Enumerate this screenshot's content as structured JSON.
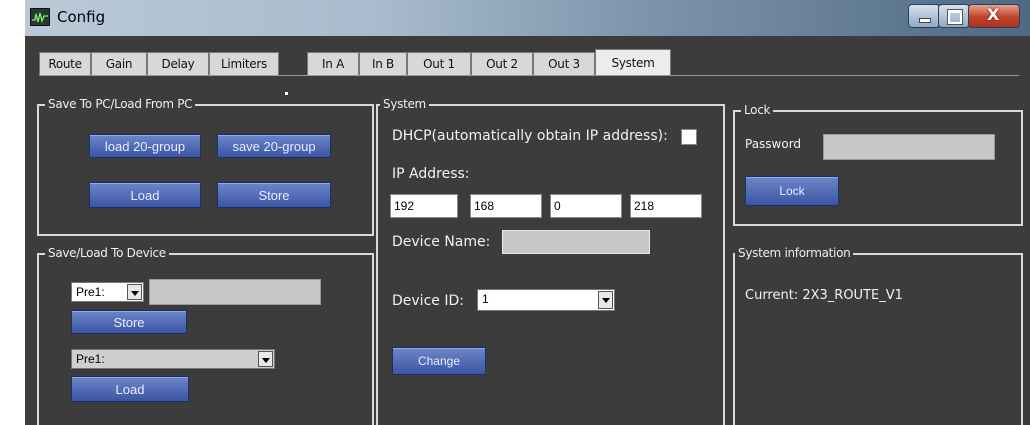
{
  "window": {
    "title": "Config",
    "icon": "waveform-icon",
    "close_glyph": "X"
  },
  "tabs": [
    {
      "label": "Route"
    },
    {
      "label": "Gain"
    },
    {
      "label": "Delay"
    },
    {
      "label": "Limiters"
    },
    {
      "label": "In A"
    },
    {
      "label": "In B"
    },
    {
      "label": "Out 1"
    },
    {
      "label": "Out 2"
    },
    {
      "label": "Out 3"
    },
    {
      "label": "System",
      "active": true
    }
  ],
  "save_pc": {
    "title": "Save To PC/Load From PC",
    "load20_label": "load 20-group",
    "save20_label": "save 20-group",
    "load_label": "Load",
    "store_label": "Store"
  },
  "save_device": {
    "title": "Save/Load To Device",
    "preset_select": "Pre1:",
    "store_label": "Store",
    "load_select": "Pre1:",
    "load_label": "Load"
  },
  "system": {
    "title": "System",
    "dhcp_label": "DHCP(automatically obtain IP address):",
    "dhcp_checked": false,
    "ip_label": "IP Address:",
    "ip": [
      "192",
      "168",
      "0",
      "218"
    ],
    "device_name_label": "Device Name:",
    "device_name_value": "",
    "device_id_label": "Device ID:",
    "device_id_value": "1",
    "change_label": "Change"
  },
  "lock": {
    "title": "Lock",
    "password_label": "Password",
    "password_value": "",
    "lock_label": "Lock"
  },
  "sysinfo": {
    "title": "System information",
    "current": "Current: 2X3_ROUTE_V1"
  },
  "colors": {
    "panel": "#3c3c3c",
    "button": "#4a63b4",
    "accent_border": "#d9d9d9"
  }
}
